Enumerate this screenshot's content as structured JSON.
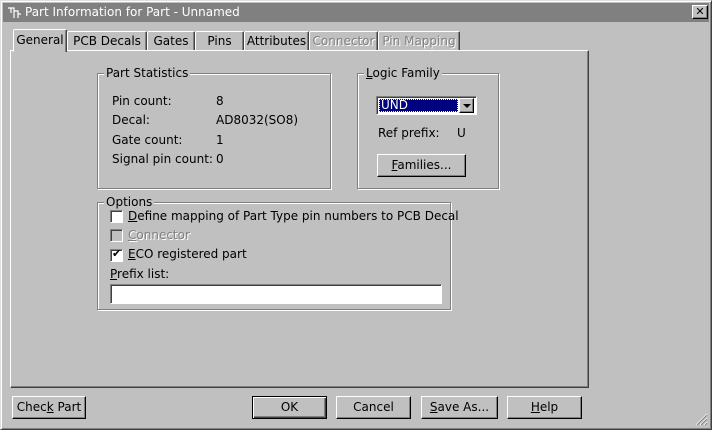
{
  "window": {
    "title": "Part Information for Part - Unnamed",
    "close_glyph": "✕"
  },
  "tabs": [
    {
      "label": "General",
      "state": "active"
    },
    {
      "label": "PCB Decals",
      "state": "normal"
    },
    {
      "label": "Gates",
      "state": "normal"
    },
    {
      "label": "Pins",
      "state": "normal"
    },
    {
      "label": "Attributes",
      "state": "normal"
    },
    {
      "label": "Connector",
      "state": "disabled"
    },
    {
      "label": "Pin Mapping",
      "state": "disabled"
    }
  ],
  "part_statistics": {
    "legend": "Part Statistics",
    "rows": [
      {
        "label": "Pin count:",
        "value": "8"
      },
      {
        "label": "Decal:",
        "value": "AD8032(SO8)"
      },
      {
        "label": "Gate count:",
        "value": "1"
      },
      {
        "label": "Signal pin count:",
        "value": "0"
      }
    ]
  },
  "logic_family": {
    "legend_mnemonic": "L",
    "legend_rest": "ogic Family",
    "selected": "UND",
    "ref_prefix_label": "Ref prefix:",
    "ref_prefix_value": "U",
    "families_button_mnemonic": "F",
    "families_button_rest": "amilies..."
  },
  "options": {
    "legend": "Options",
    "define_mapping": {
      "mnemonic": "D",
      "rest": "efine mapping of Part Type pin numbers to PCB Decal",
      "checked": false
    },
    "connector": {
      "mnemonic": "C",
      "rest": "onnector",
      "checked": false,
      "disabled": true
    },
    "eco_registered": {
      "mnemonic": "E",
      "rest": "CO registered part",
      "checked": true,
      "check_glyph": "✔"
    },
    "prefix_list_label_mnemonic": "P",
    "prefix_list_label_rest": "refix list:",
    "prefix_list_value": ""
  },
  "buttons": {
    "check_part": {
      "pre": "Chec",
      "mnemonic": "k",
      "post": " Part"
    },
    "ok": "OK",
    "cancel": "Cancel",
    "save_as": {
      "mnemonic": "S",
      "rest": "ave As..."
    },
    "help": {
      "mnemonic": "H",
      "rest": "elp"
    }
  },
  "colors": {
    "face": "#c0c0c0",
    "titlebar": "#808080",
    "selection": "#000080"
  }
}
